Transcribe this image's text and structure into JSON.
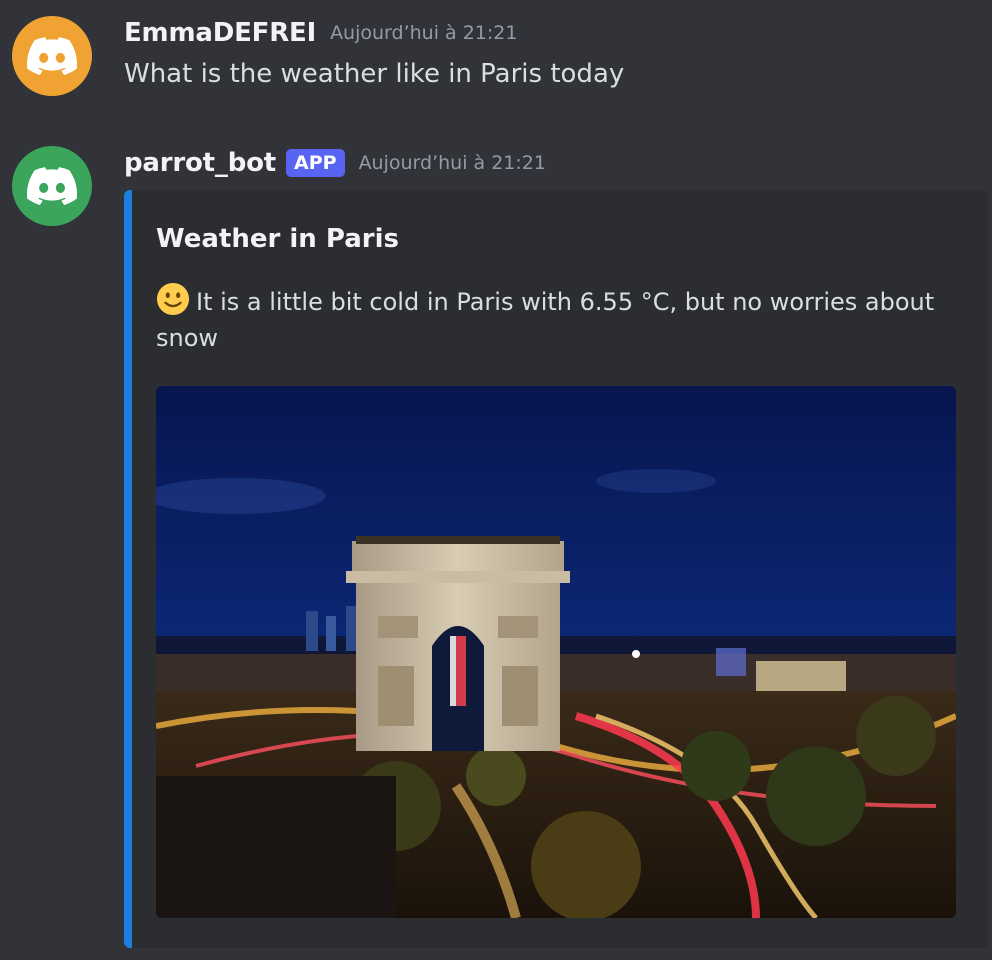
{
  "messages": [
    {
      "username": "EmmaDEFREI",
      "timestamp": "Aujourd’hui à 21:21",
      "text": "What is the weather like in Paris today",
      "avatar_icon": "discord-logo-icon",
      "avatar_color": "#f0a232"
    },
    {
      "username": "parrot_bot",
      "badge": "APP",
      "timestamp": "Aujourd’hui à 21:21",
      "avatar_icon": "discord-logo-icon",
      "avatar_color": "#3ba55c",
      "embed": {
        "title": "Weather in Paris",
        "description": "It is a little bit cold in Paris with 6.55 °C, but no worries about snow",
        "emoji": "slightly-smiling-face-icon",
        "accent_color": "#1c7fe0",
        "image_alt": "Arc de Triomphe at night with light trails"
      }
    }
  ],
  "colors": {
    "background": "#313338",
    "embed_background": "#2b2d31",
    "app_badge": "#5865f2",
    "timestamp": "#949ba4"
  }
}
